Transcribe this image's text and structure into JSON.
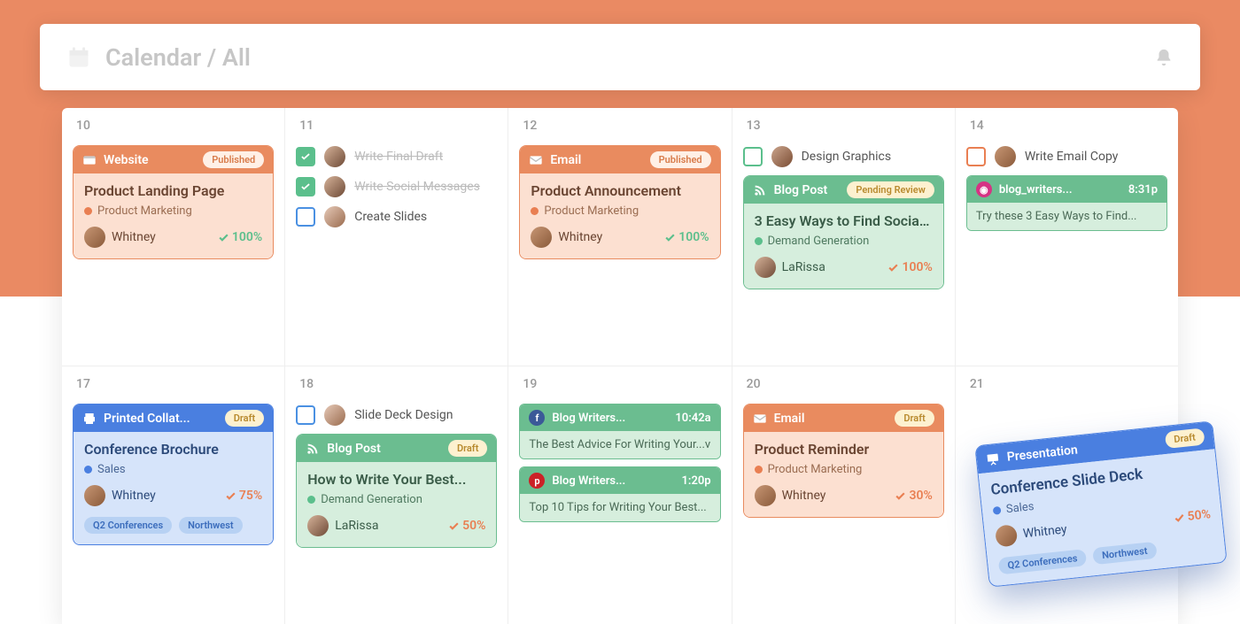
{
  "header": {
    "title": "Calendar / All"
  },
  "icons": {
    "website": "website-icon",
    "email": "email-icon",
    "blog": "rss-icon",
    "print": "print-icon",
    "presentation": "presentation-icon",
    "instagram": "instagram-icon",
    "facebook": "facebook-icon",
    "pinterest": "pinterest-icon"
  },
  "colors": {
    "orange": "#e98b5f",
    "green": "#6bbd90",
    "blue": "#4a7fe0"
  },
  "rows": [
    {
      "cells": [
        {
          "day": "10",
          "items": [
            {
              "kind": "card",
              "color": "orange",
              "type": "Website",
              "badge": "Published",
              "badgeStyle": "published",
              "title": "Product Landing Page",
              "cat": "Product Marketing",
              "catDot": "orange",
              "owner": "Whitney",
              "pct": "100%",
              "pctColor": "green"
            }
          ]
        },
        {
          "day": "11",
          "items": [
            {
              "kind": "task",
              "checked": true,
              "cb": "green",
              "label": "Write Final Draft",
              "done": true
            },
            {
              "kind": "task",
              "checked": true,
              "cb": "green",
              "label": "Write Social Messages",
              "done": true
            },
            {
              "kind": "task",
              "checked": false,
              "cb": "blue",
              "label": "Create Slides",
              "done": false
            }
          ]
        },
        {
          "day": "12",
          "items": [
            {
              "kind": "card",
              "color": "orange",
              "type": "Email",
              "badge": "Published",
              "badgeStyle": "published",
              "title": "Product Announcement",
              "cat": "Product Marketing",
              "catDot": "orange",
              "owner": "Whitney",
              "pct": "100%",
              "pctColor": "green"
            }
          ]
        },
        {
          "day": "13",
          "items": [
            {
              "kind": "task",
              "checked": false,
              "cb": "green",
              "label": "Design Graphics",
              "done": false
            },
            {
              "kind": "card",
              "color": "green",
              "type": "Blog Post",
              "badge": "Pending Review",
              "badgeStyle": "pending",
              "title": "3 Easy Ways to Find Social...",
              "cat": "Demand Generation",
              "catDot": "green",
              "owner": "LaRissa",
              "pct": "100%",
              "pctColor": "orange"
            }
          ]
        },
        {
          "day": "14",
          "items": [
            {
              "kind": "task",
              "checked": false,
              "cb": "orange",
              "label": "Write Email Copy",
              "done": false
            },
            {
              "kind": "social",
              "net": "instagram",
              "handle": "blog_writers...",
              "time": "8:31p",
              "text": "Try these 3 Easy Ways to Find..."
            }
          ]
        }
      ]
    },
    {
      "cells": [
        {
          "day": "17",
          "items": [
            {
              "kind": "card",
              "color": "blue",
              "type": "Printed Collat...",
              "badge": "Draft",
              "badgeStyle": "draft",
              "title": "Conference Brochure",
              "cat": "Sales",
              "catDot": "blue",
              "owner": "Whitney",
              "pct": "75%",
              "pctColor": "orange",
              "tags": [
                "Q2 Conferences",
                "Northwest"
              ]
            }
          ]
        },
        {
          "day": "18",
          "items": [
            {
              "kind": "task",
              "checked": false,
              "cb": "blue",
              "label": "Slide Deck Design",
              "done": false
            },
            {
              "kind": "card",
              "color": "green",
              "type": "Blog Post",
              "badge": "Draft",
              "badgeStyle": "draft",
              "title": "How to Write Your Best...",
              "cat": "Demand Generation",
              "catDot": "green",
              "owner": "LaRissa",
              "pct": "50%",
              "pctColor": "orange"
            }
          ]
        },
        {
          "day": "19",
          "items": [
            {
              "kind": "social",
              "net": "facebook",
              "handle": "Blog Writers...",
              "time": "10:42a",
              "text": "The Best Advice For Writing Your...v"
            },
            {
              "kind": "social",
              "net": "pinterest",
              "handle": "Blog Writers...",
              "time": "1:20p",
              "text": "Top 10 Tips for Writing Your Best..."
            }
          ]
        },
        {
          "day": "20",
          "items": [
            {
              "kind": "card",
              "color": "orange",
              "type": "Email",
              "badge": "Draft",
              "badgeStyle": "draft",
              "title": "Product Reminder",
              "cat": "Product Marketing",
              "catDot": "orange",
              "owner": "Whitney",
              "pct": "30%",
              "pctColor": "orange"
            }
          ]
        },
        {
          "day": "21",
          "items": []
        }
      ]
    }
  ],
  "floating": {
    "type": "Presentation",
    "badge": "Draft",
    "badgeStyle": "draft",
    "title": "Conference Slide Deck",
    "cat": "Sales",
    "catDot": "blue",
    "owner": "Whitney",
    "pct": "50%",
    "pctColor": "orange",
    "tags": [
      "Q2 Conferences",
      "Northwest"
    ]
  }
}
